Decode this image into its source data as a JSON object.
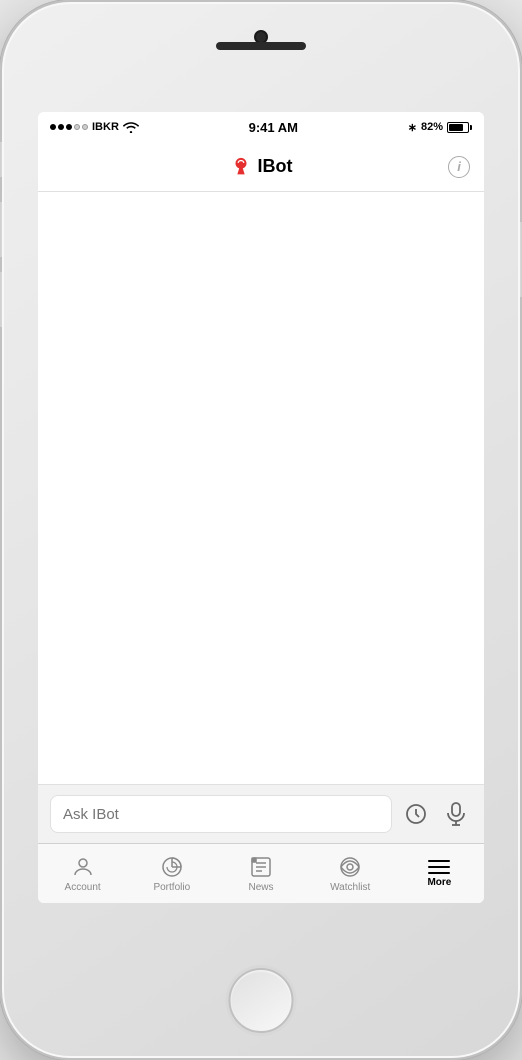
{
  "phone": {
    "status_bar": {
      "carrier": "IBKR",
      "time": "9:41 AM",
      "battery_percent": "82%"
    },
    "nav": {
      "title": "IBot",
      "info_label": "i"
    },
    "input": {
      "placeholder": "Ask IBot"
    },
    "tabs": [
      {
        "id": "account",
        "label": "Account",
        "active": false
      },
      {
        "id": "portfolio",
        "label": "Portfolio",
        "active": false
      },
      {
        "id": "news",
        "label": "News",
        "active": false
      },
      {
        "id": "watchlist",
        "label": "Watchlist",
        "active": false
      },
      {
        "id": "more",
        "label": "More",
        "active": true
      }
    ]
  }
}
